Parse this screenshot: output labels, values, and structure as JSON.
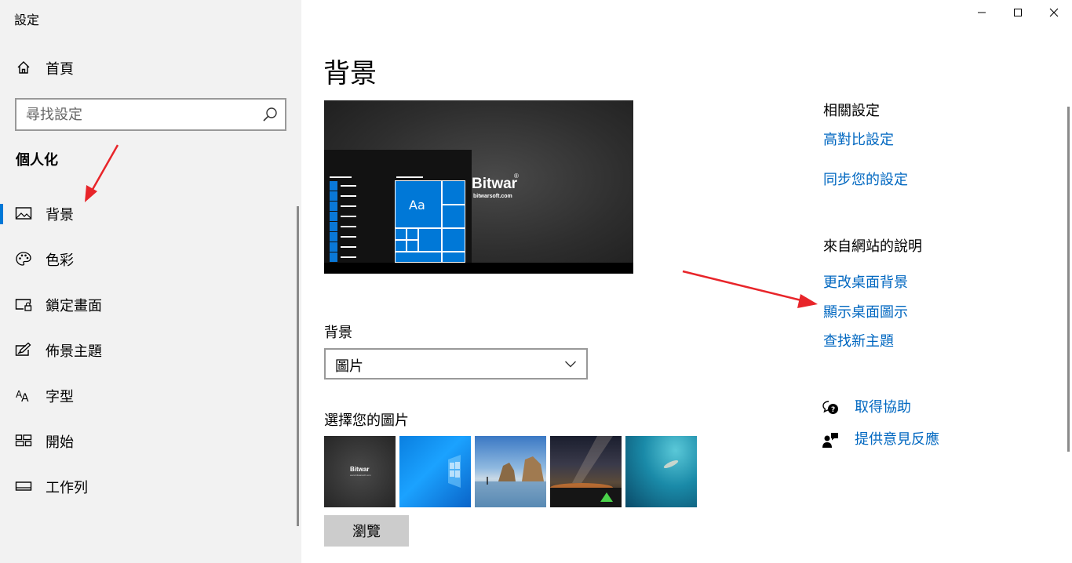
{
  "app": {
    "title": "設定"
  },
  "sidebar": {
    "home_label": "首頁",
    "search_placeholder": "尋找設定",
    "section_title": "個人化",
    "items": [
      {
        "label": "背景",
        "icon": "picture-icon",
        "active": true
      },
      {
        "label": "色彩",
        "icon": "palette-icon",
        "active": false
      },
      {
        "label": "鎖定畫面",
        "icon": "lock-screen-icon",
        "active": false
      },
      {
        "label": "佈景主題",
        "icon": "theme-edit-icon",
        "active": false
      },
      {
        "label": "字型",
        "icon": "font-icon",
        "active": false
      },
      {
        "label": "開始",
        "icon": "start-tiles-icon",
        "active": false
      },
      {
        "label": "工作列",
        "icon": "taskbar-icon",
        "active": false
      }
    ]
  },
  "window_controls": {
    "icons": [
      "minimize-icon",
      "maximize-icon",
      "close-icon"
    ]
  },
  "main": {
    "title": "背景",
    "preview": {
      "tile_label": "Aa",
      "watermark_brand": "Bitwar",
      "watermark_url": "bitwarsoft.com",
      "watermark_mark": "®"
    },
    "background_label": "背景",
    "background_value": "圖片",
    "choose_label": "選擇您的圖片",
    "thumb_brand": "Bitwar",
    "thumb_url": "www.bitwarsoft.com",
    "browse_label": "瀏覽"
  },
  "related": {
    "heading": "相關設定",
    "links": [
      "高對比設定",
      "同步您的設定"
    ]
  },
  "web_help": {
    "heading": "來自網站的說明",
    "links": [
      "更改桌面背景",
      "顯示桌面圖示",
      "查找新主題"
    ]
  },
  "support": {
    "get_help": "取得協助",
    "feedback": "提供意見反應"
  },
  "colors": {
    "accent": "#0078d7",
    "link": "#0067c0",
    "annotation_arrow": "#e8252a",
    "sidebar_bg": "#f2f2f2"
  }
}
